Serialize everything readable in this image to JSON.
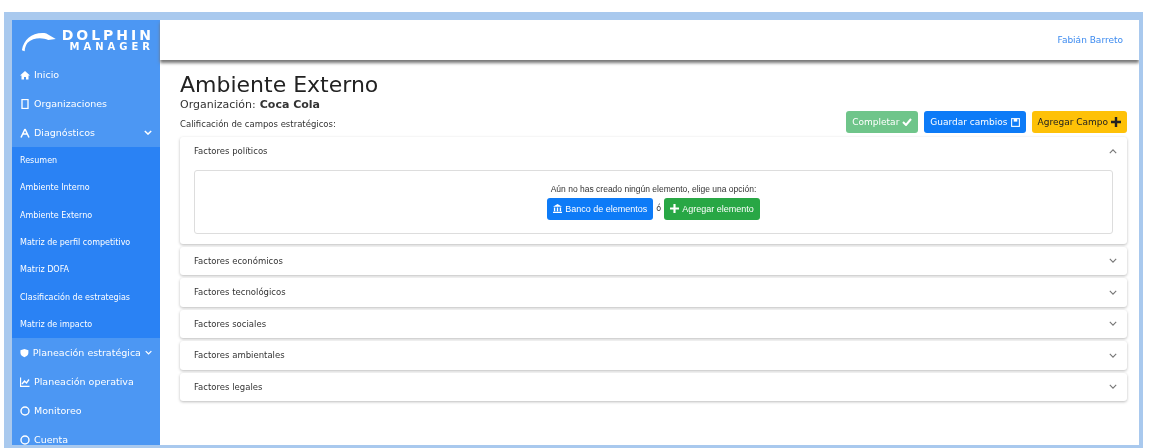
{
  "logo": {
    "line_1": "DOLPHIN",
    "line_2": "MANAGER"
  },
  "sidebar": {
    "items": [
      {
        "label": "Inicio"
      },
      {
        "label": "Organizaciones"
      },
      {
        "label": "Diagnósticos",
        "kind": "group",
        "expanded": true,
        "children": [
          {
            "label": "Resumen"
          },
          {
            "label": "Ambiente Interno"
          },
          {
            "label": "Ambiente Externo"
          },
          {
            "label": "Matriz de perfil competitivo"
          },
          {
            "label": "Matriz DOFA"
          },
          {
            "label": "Clasificación de estrategias"
          },
          {
            "label": "Matriz de impacto"
          }
        ]
      },
      {
        "label": "Planeación estratégica",
        "kind": "group"
      },
      {
        "label": "Planeación operativa"
      },
      {
        "label": "Monitoreo"
      },
      {
        "label": "Cuenta"
      }
    ]
  },
  "top_bar": {
    "user": "Fabián Barreto"
  },
  "page": {
    "title": "Ambiente Externo",
    "organization_label": "Organización:",
    "organization": "Coca Cola",
    "subtitle": "Calificación de campos estratégicos:",
    "buttons": [
      {
        "label": "Completar",
        "kind": "complete"
      },
      {
        "label": "Guardar cambios",
        "kind": "save"
      },
      {
        "label": "Agregar Campo",
        "kind": "add"
      }
    ]
  },
  "panels": [
    {
      "title": "Factores políticos",
      "expanded": true,
      "empty_message": "Aún no has creado ningún elemento, elige una opción:",
      "bank_button": "Banco de elementos",
      "separator": "ó",
      "add_button": "Agregar elemento"
    },
    {
      "title": "Factores económicos",
      "expanded": false
    },
    {
      "title": "Factores tecnológicos",
      "expanded": false
    },
    {
      "title": "Factores sociales",
      "expanded": false
    },
    {
      "title": "Factores ambientales",
      "expanded": false
    },
    {
      "title": "Factores legales",
      "expanded": false
    }
  ]
}
